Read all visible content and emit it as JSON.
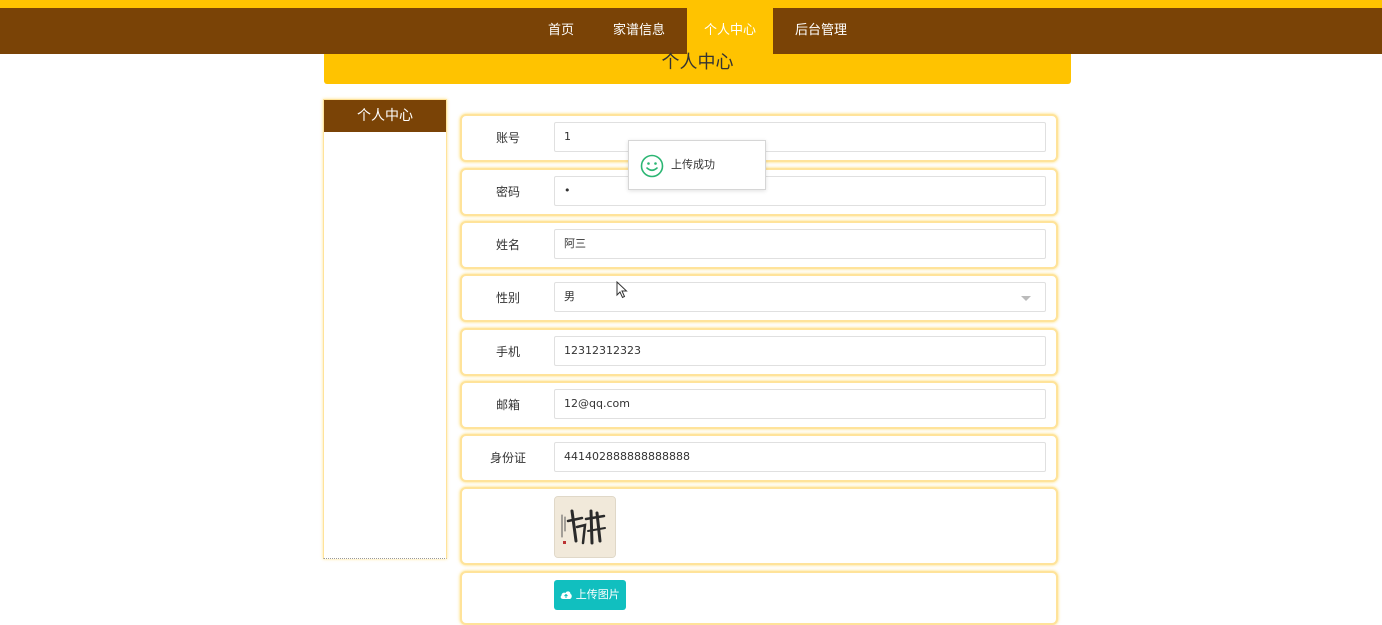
{
  "nav": {
    "items": [
      {
        "label": "首页"
      },
      {
        "label": "家谱信息"
      },
      {
        "label": "个人中心"
      },
      {
        "label": "后台管理"
      }
    ],
    "active_index": 2
  },
  "banner": {
    "title": "个人中心"
  },
  "sidebar": {
    "title": "个人中心"
  },
  "form": {
    "account": {
      "label": "账号",
      "value": "1"
    },
    "password": {
      "label": "密码",
      "value": "•"
    },
    "name": {
      "label": "姓名",
      "value": "阿三"
    },
    "gender": {
      "label": "性别",
      "value": "男"
    },
    "phone": {
      "label": "手机",
      "value": "12312312323"
    },
    "email": {
      "label": "邮箱",
      "value": "12@qq.com"
    },
    "id_card": {
      "label": "身份证",
      "value": "441402888888888888"
    },
    "upload_label": "上传图片"
  },
  "toast": {
    "message": "上传成功"
  },
  "colors": {
    "accent": "#ffc300",
    "nav_bg": "#7a4306",
    "upload_btn": "#11bfbf",
    "toast_icon": "#2bb673"
  },
  "icons": [
    "smile-icon",
    "cloud-upload-icon",
    "chevron-down-icon",
    "mouse-cursor-icon"
  ]
}
